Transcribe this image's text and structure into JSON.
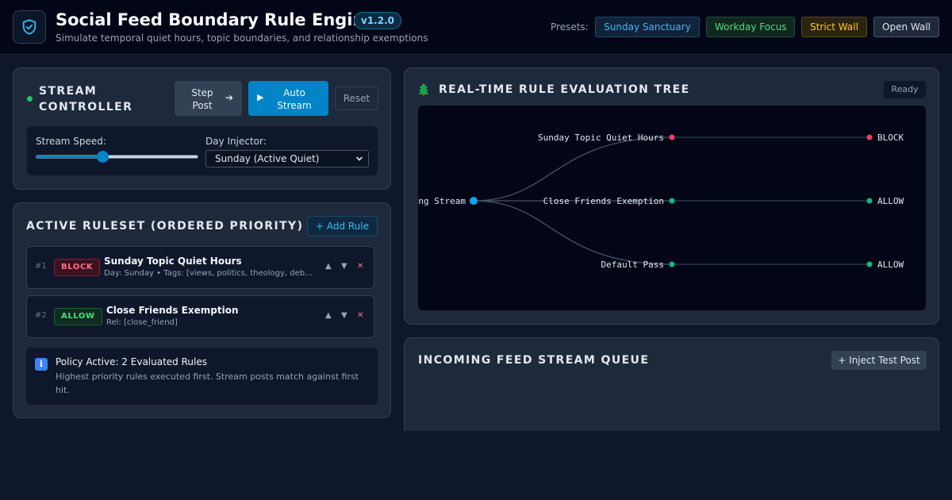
{
  "header": {
    "title": "Social Feed Boundary Rule Engine",
    "version": "v1.2.0",
    "subtitle": "Simulate temporal quiet hours, topic boundaries, and relationship exemptions",
    "presets_label": "Presets:",
    "presets": [
      "Sunday Sanctuary",
      "Workday Focus",
      "Strict Wall",
      "Open Wall"
    ]
  },
  "stream_controller": {
    "title": "Stream Controller",
    "step_label": "Step Post",
    "step_arrow": "➔",
    "auto_icon": "▶",
    "auto_label": "Auto Stream",
    "reset_label": "Reset",
    "speed_label": "Stream Speed:",
    "speed_value": 0.41,
    "day_label": "Day Injector:",
    "day_selected": "Sunday (Active Quiet)"
  },
  "ruleset": {
    "title": "Active Ruleset (Ordered Priority)",
    "add_label": "+ Add Rule",
    "rules": [
      {
        "num": "#1",
        "action": "BLOCK",
        "name": "Sunday Topic Quiet Hours",
        "meta": "Day: Sunday • Tags: [views, politics, theology, debate]"
      },
      {
        "num": "#2",
        "action": "ALLOW",
        "name": "Close Friends Exemption",
        "meta": "Rel: [close_friend]"
      }
    ],
    "controls": {
      "up": "▲",
      "down": "▼",
      "delete": "✕"
    },
    "info_icon": "i",
    "info_title": "Policy Active: 2 Evaluated Rules",
    "info_text": "Highest priority rules executed first. Stream posts match against first hit."
  },
  "tree": {
    "title": "Real-Time Rule Evaluation Tree",
    "status": "Ready",
    "root_label": "Incoming Stream",
    "branches": [
      {
        "label": "Sunday Topic Quiet Hours",
        "outcome": "BLOCK"
      },
      {
        "label": "Close Friends Exemption",
        "outcome": "ALLOW"
      },
      {
        "label": "Default Pass",
        "outcome": "ALLOW"
      }
    ]
  },
  "queue": {
    "title": "Incoming Feed Stream Queue",
    "inject_label": "+ Inject Test Post"
  },
  "colors": {
    "accent": "#0284c7",
    "block": "#f43f5e",
    "allow": "#10b981",
    "root": "#0ea5e9"
  },
  "icons": {
    "logo": "shield-check-icon",
    "tree": "evergreen-tree-icon",
    "info": "info-icon",
    "chevron": "chevron-down-icon"
  }
}
